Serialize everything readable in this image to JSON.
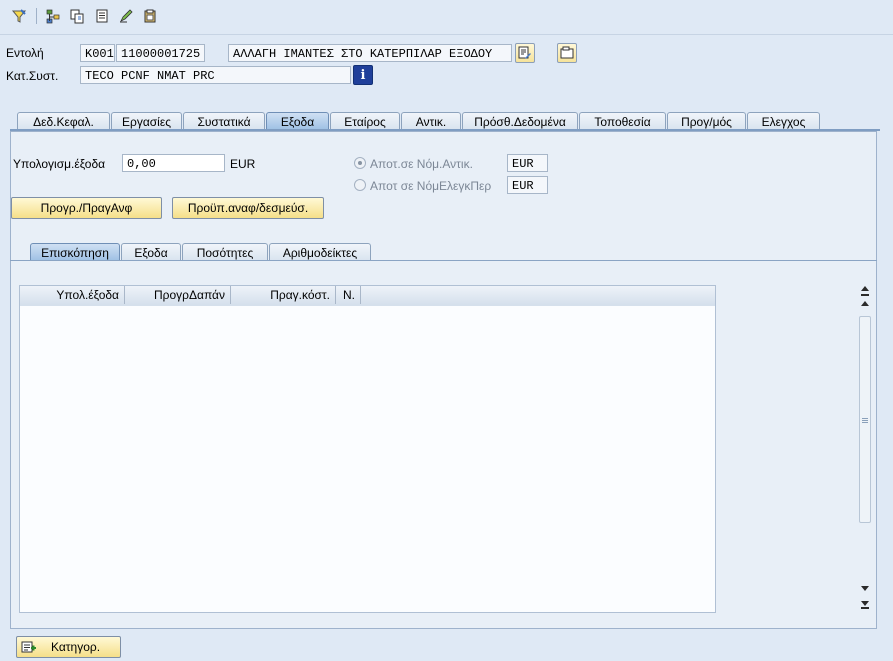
{
  "toolbar": {
    "icons": [
      "filter-icon",
      "hierarchy-icon",
      "copy-icon",
      "document-icon",
      "pen-icon",
      "clipboard-icon"
    ]
  },
  "header": {
    "order_label": "Εντολή",
    "order_type": "K001",
    "order_number": "11000001725",
    "order_description": "ΑΛΛΑΓΗ ΙΜΑΝΤΕΣ ΣΤΟ ΚΑΤΕΡΠΙΛΑΡ ΕΞΟΔΟΥ",
    "status_label": "Κατ.Συστ.",
    "status_value": "TECO PCNF NMAT PRC"
  },
  "main_tabs": [
    {
      "label": "Δεδ.Κεφαλ."
    },
    {
      "label": "Εργασίες"
    },
    {
      "label": "Συστατικά"
    },
    {
      "label": "Εξοδα"
    },
    {
      "label": "Εταίρος"
    },
    {
      "label": "Αντικ."
    },
    {
      "label": "Πρόσθ.Δεδομένα"
    },
    {
      "label": "Τοποθεσία"
    },
    {
      "label": "Προγ/μός"
    },
    {
      "label": "Ελεγχος"
    }
  ],
  "costs": {
    "calc_label": "Υπολογισμ.έξοδα",
    "calc_value": "0,00",
    "currency": "EUR",
    "radio1_label": "Αποτ.σε Νόμ.Αντικ.",
    "radio1_value": "EUR",
    "radio2_label": "Αποτ σε ΝόμΕλεγκΠερ",
    "radio2_value": "EUR",
    "btn_plan_actual": "Προγρ./ΠραγΑνφ",
    "btn_budget": "Προϋπ.αναφ/δεσμεύσ."
  },
  "sub_tabs": [
    {
      "label": "Επισκόπηση"
    },
    {
      "label": "Εξοδα"
    },
    {
      "label": "Ποσότητες"
    },
    {
      "label": "Αριθμοδείκτες"
    }
  ],
  "table": {
    "columns": [
      "Υπολ.έξοδα",
      "ΠρογρΔαπάν",
      "Πραγ.κόστ.",
      "Ν."
    ]
  },
  "footer": {
    "category_button": "Κατηγορ."
  }
}
